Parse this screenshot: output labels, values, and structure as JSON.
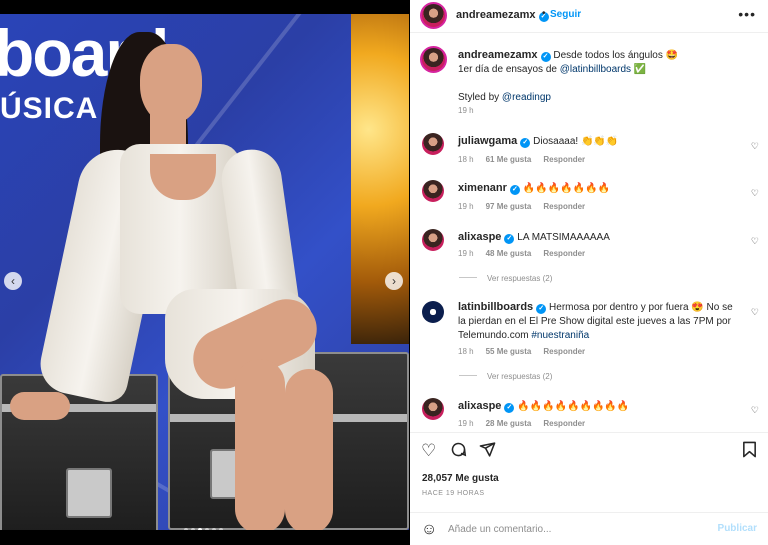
{
  "post": {
    "photo_text": {
      "logo": "board",
      "sub": "ÚSICA   NA"
    },
    "carousel": {
      "total": 6,
      "active": 2
    }
  },
  "header": {
    "username": "andreamezamx",
    "follow_label": "Seguir",
    "more_label": "•••"
  },
  "caption": {
    "username": "andreamezamx",
    "line1": "Desde todos los ángulos 🤩",
    "line2_prefix": "1er día de ensayos de ",
    "line2_mention": "@latinbillboards",
    "line2_suffix": " ✅",
    "styled_prefix": "Styled by ",
    "styled_mention": "@readingp",
    "time": "19 h"
  },
  "comments": [
    {
      "username": "juliawgama",
      "verified": true,
      "text": "Diosaaaa! 👏👏👏",
      "time": "18 h",
      "likes": "61 Me gusta",
      "reply": "Responder"
    },
    {
      "username": "ximenanr",
      "verified": true,
      "text": "🔥🔥🔥🔥🔥🔥🔥",
      "time": "19 h",
      "likes": "97 Me gusta",
      "reply": "Responder"
    },
    {
      "username": "alixaspe",
      "verified": true,
      "text": "LA MATSIMAAAAAA",
      "time": "19 h",
      "likes": "48 Me gusta",
      "reply": "Responder",
      "view_replies": "Ver respuestas (2)"
    },
    {
      "username": "latinbillboards",
      "verified": true,
      "text_line1": "Hermosa por dentro y por fuera 😍 No se",
      "text_line2": "la pierdan en el El Pre Show digital este jueves a las 7PM por",
      "text_line3_prefix": "Telemundo.com ",
      "text_line3_tag": "#nuestraniña",
      "time": "18 h",
      "likes": "55 Me gusta",
      "reply": "Responder",
      "view_replies": "Ver respuestas (2)"
    },
    {
      "username": "alixaspe",
      "verified": true,
      "text": "🔥🔥🔥🔥🔥🔥🔥🔥🔥",
      "time": "19 h",
      "likes": "28 Me gusta",
      "reply": "Responder"
    }
  ],
  "actions": {
    "like_icon": "heart-icon",
    "comment_icon": "comment-icon",
    "share_icon": "share-icon",
    "save_icon": "bookmark-icon",
    "likes_count": "28,057 Me gusta",
    "posted_ago": "HACE 19 HORAS"
  },
  "comment_box": {
    "placeholder": "Añade un comentario...",
    "publish_label": "Publicar"
  }
}
